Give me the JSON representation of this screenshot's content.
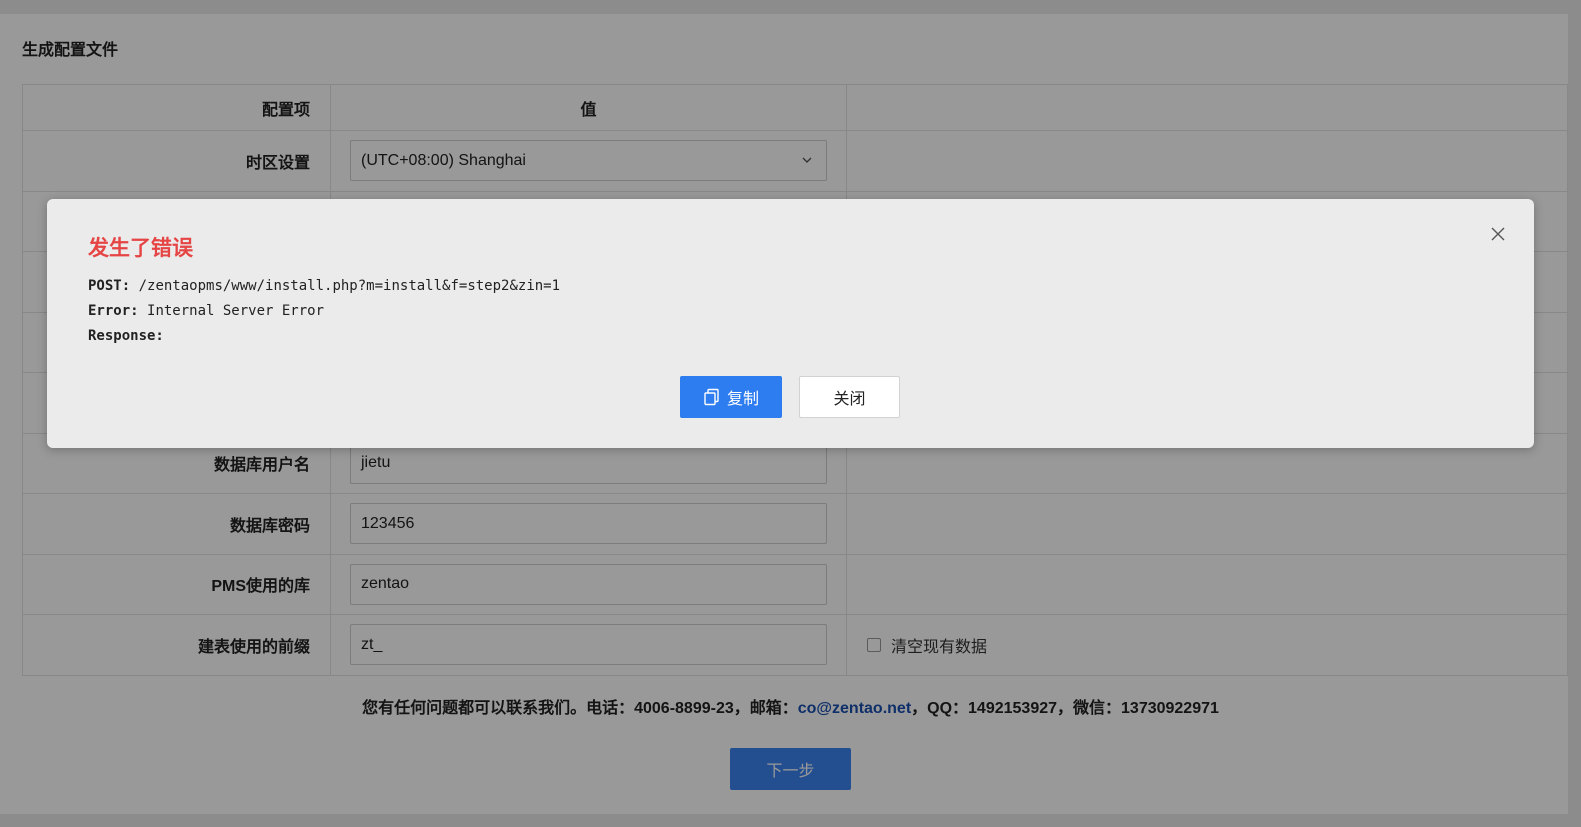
{
  "page": {
    "title": "生成配置文件",
    "columns": {
      "item": "配置项",
      "value": "值"
    },
    "rows": [
      {
        "label": "时区设置",
        "value": "(UTC+08:00) Shanghai",
        "type": "select"
      },
      {
        "label": "",
        "value": "",
        "type": "input"
      },
      {
        "label": "",
        "value": "",
        "type": "input"
      },
      {
        "label": "",
        "value": "",
        "type": "input"
      },
      {
        "label": "",
        "value": "",
        "type": "input"
      },
      {
        "label": "数据库用户名",
        "value": "jietu",
        "type": "input"
      },
      {
        "label": "数据库密码",
        "value": "123456",
        "type": "input"
      },
      {
        "label": "PMS使用的库",
        "value": "zentao",
        "type": "input"
      },
      {
        "label": "建表使用的前缀",
        "value": "zt_",
        "type": "input",
        "extra_checkbox": "清空现有数据"
      }
    ],
    "contact": {
      "prefix": "您有任何问题都可以联系我们。电话：4006-8899-23，邮箱：",
      "email": "co@zentao.net",
      "suffix": "，QQ：1492153927，微信：13730922971"
    },
    "next_button": "下一步"
  },
  "modal": {
    "title": "发生了错误",
    "post_label": "POST:",
    "post_value": "/zentaopms/www/install.php?m=install&f=step2&zin=1",
    "error_label": "Error:",
    "error_value": "Internal Server Error",
    "response_label": "Response:",
    "copy_button": "复制",
    "close_button": "关闭"
  },
  "colors": {
    "primary": "#2d7cf0",
    "error_title": "#e64545",
    "link": "#1a4fb0"
  }
}
